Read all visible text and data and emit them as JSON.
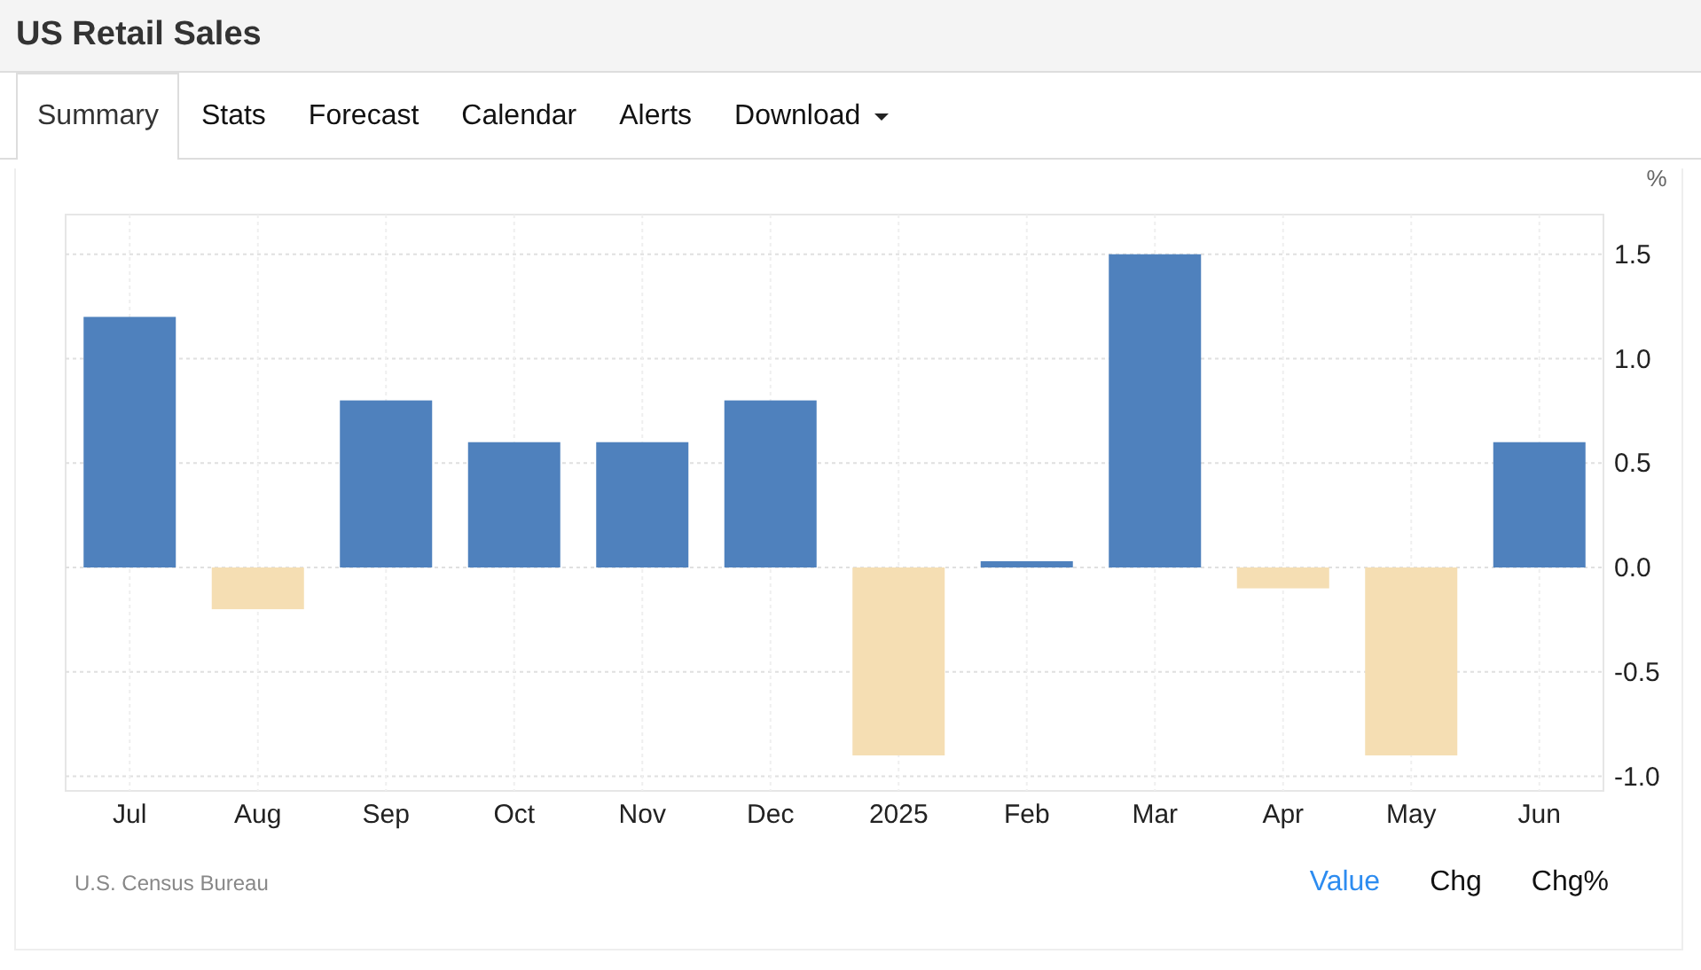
{
  "header": {
    "title": "US Retail Sales"
  },
  "tabs": [
    {
      "label": "Summary",
      "selected": true
    },
    {
      "label": "Stats",
      "selected": false
    },
    {
      "label": "Forecast",
      "selected": false
    },
    {
      "label": "Calendar",
      "selected": false
    },
    {
      "label": "Alerts",
      "selected": false
    },
    {
      "label": "Download",
      "selected": false,
      "dropdown": true
    }
  ],
  "chart": {
    "chart_data": {
      "type": "bar",
      "ylabel": "%",
      "categories": [
        "Jul",
        "Aug",
        "Sep",
        "Oct",
        "Nov",
        "Dec",
        "2025",
        "Feb",
        "Mar",
        "Apr",
        "May",
        "Jun"
      ],
      "series": [
        {
          "color": "#4f81bd",
          "values": [
            1.2,
            null,
            0.8,
            0.6,
            0.6,
            0.8,
            null,
            0.03,
            1.5,
            null,
            null,
            0.6
          ]
        },
        {
          "color": "#f5deb3",
          "values": [
            null,
            -0.2,
            null,
            null,
            null,
            null,
            -0.9,
            null,
            null,
            -0.1,
            -0.9,
            null
          ]
        }
      ],
      "stacked": true,
      "grid": true,
      "ylim": [
        -1.07,
        1.69
      ],
      "yticks": [
        {
          "value": 1.5,
          "label": "1.5"
        },
        {
          "value": 1,
          "label": "1.0"
        },
        {
          "value": 0.5,
          "label": "0.5"
        },
        {
          "value": 0,
          "label": "0.0"
        },
        {
          "value": -0.5,
          "label": "-0.5"
        },
        {
          "value": -1,
          "label": "-1.0"
        }
      ]
    }
  },
  "source": "U.S. Census Bureau",
  "views": [
    {
      "label": "Value",
      "selected": true
    },
    {
      "label": "Chg",
      "selected": false
    },
    {
      "label": "Chg%",
      "selected": false
    }
  ]
}
